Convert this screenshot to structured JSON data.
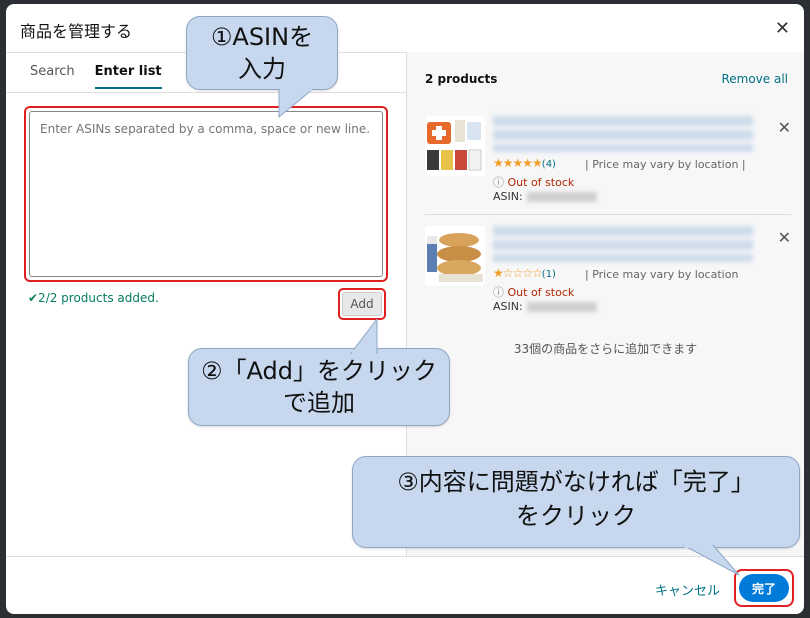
{
  "modal": {
    "title": "商品を管理する"
  },
  "tabs": [
    {
      "label": "Search"
    },
    {
      "label": "Enter list"
    }
  ],
  "input": {
    "placeholder": "Enter ASINs separated by a comma, space or new line."
  },
  "status": {
    "added": "✔2/2 products added."
  },
  "add_button": "Add",
  "right": {
    "count": "2 products",
    "remove_all": "Remove all",
    "products": [
      {
        "rating": 5,
        "stars": "★★★★★",
        "rating_count": "(4)",
        "price_note": "Price may vary by location",
        "stock": "Out of stock",
        "asin_label": "ASIN:"
      },
      {
        "rating": 1,
        "stars": "★☆☆☆☆",
        "rating_count": "(1)",
        "price_note": "Price may vary by location",
        "stock": "Out of stock",
        "asin_label": "ASIN:"
      }
    ],
    "more_text": "33個の商品をさらに追加できます"
  },
  "footer": {
    "cancel": "キャンセル",
    "done": "完了"
  },
  "callouts": {
    "c1_line1": "①ASINを",
    "c1_line2": "入力",
    "c2_line1": "②「Add」をクリック",
    "c2_line2": "で追加",
    "c3_line1": "③内容に問題がなければ「完了」",
    "c3_line2": "をクリック"
  },
  "colors": {
    "accent": "#007185",
    "primary": "#007bd8",
    "highlight": "#e02020",
    "callout": "#c6d7ee",
    "star": "#f19e2a",
    "error": "#b12704",
    "success": "#067d62"
  }
}
